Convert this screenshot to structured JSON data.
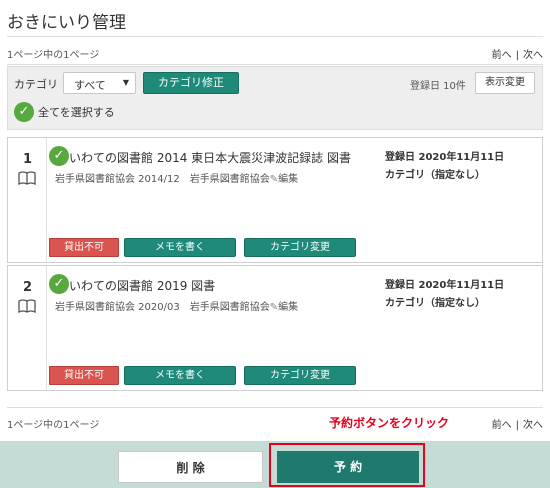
{
  "page_title": "おきにいり管理",
  "pager": {
    "info": "1ページ中の1ページ",
    "prev": "前へ",
    "next": "次へ",
    "separator": "|"
  },
  "toolbar": {
    "category_label": "カテゴリ",
    "category_select_value": "すべて",
    "category_edit_label": "カテゴリ修正",
    "registered_count": "登録日 10件",
    "display_change_label": "表示変更",
    "select_all_label": "全てを選択する"
  },
  "items": [
    {
      "number": "1",
      "title": "いわての図書館 2014 東日本大震災津波記録誌 図書",
      "publisher": "岩手県図書館協会 2014/12　岩手県図書館協会",
      "editor_suffix": "編集",
      "registered": "登録日 2020年11月11日",
      "category": "カテゴリ（指定なし）",
      "status": "貸出不可",
      "memo_label": "メモを書く",
      "category_change_label": "カテゴリ変更"
    },
    {
      "number": "2",
      "title": "いわての図書館 2019 図書",
      "publisher": "岩手県図書館協会 2020/03　岩手県図書館協会",
      "editor_suffix": "編集",
      "registered": "登録日 2020年11月11日",
      "category": "カテゴリ（指定なし）",
      "status": "貸出不可",
      "memo_label": "メモを書く",
      "category_change_label": "カテゴリ変更"
    }
  ],
  "annotation": "予約ボタンをクリック",
  "footer": {
    "delete_label": "削 除",
    "reserve_label": "予 約"
  },
  "colors": {
    "accent_teal": "#1f8a7a",
    "status_red": "#d9534f",
    "highlight_red": "#e8001c",
    "footer_bg": "#c5dcd6"
  }
}
